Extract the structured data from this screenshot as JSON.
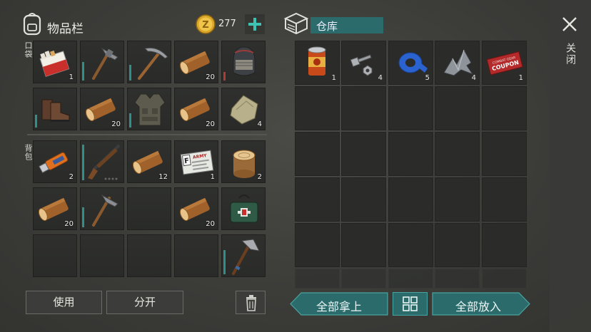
{
  "inventory": {
    "title": "物品栏",
    "currency_amount": "277",
    "currency_symbol": "Z",
    "pocket_label": "口袋",
    "backpack_label": "背包",
    "pocket_slots": [
      {
        "item": "cigarettes",
        "count": "1"
      },
      {
        "item": "pickaxe-hammer",
        "count": ""
      },
      {
        "item": "pickaxe",
        "count": ""
      },
      {
        "item": "log",
        "count": "20"
      },
      {
        "item": "helmet",
        "count": ""
      },
      {
        "item": "boots",
        "count": ""
      },
      {
        "item": "log",
        "count": "20"
      },
      {
        "item": "armor-vest",
        "count": ""
      },
      {
        "item": "log",
        "count": "20"
      },
      {
        "item": "cloth",
        "count": "4"
      }
    ],
    "backpack_slots": [
      {
        "item": "usb-flash",
        "count": "2"
      },
      {
        "item": "shotgun",
        "count": ""
      },
      {
        "item": "log",
        "count": "12"
      },
      {
        "item": "army-id-card",
        "count": "1"
      },
      {
        "item": "log-stump",
        "count": "2"
      },
      {
        "item": "log",
        "count": "20"
      },
      {
        "item": "hammer",
        "count": ""
      },
      {
        "item": "empty",
        "count": ""
      },
      {
        "item": "log",
        "count": "20"
      },
      {
        "item": "medkit-bag",
        "count": ""
      },
      {
        "item": "empty",
        "count": ""
      },
      {
        "item": "empty",
        "count": ""
      },
      {
        "item": "empty",
        "count": ""
      },
      {
        "item": "empty",
        "count": ""
      },
      {
        "item": "hatchet",
        "count": ""
      }
    ],
    "card_text": "ARMY",
    "card_letter": "F",
    "use_button": "使用",
    "split_button": "分开"
  },
  "storage": {
    "title": "仓库",
    "slots": [
      {
        "item": "canned-food",
        "count": "1"
      },
      {
        "item": "bolts-nuts",
        "count": "4"
      },
      {
        "item": "duct-tape",
        "count": "5"
      },
      {
        "item": "metal-scrap",
        "count": "4"
      },
      {
        "item": "coupon-ticket",
        "count": "1"
      }
    ],
    "coupon_text_1": "COMBAT GEAR",
    "coupon_text_2": "COUPON",
    "take_all_button": "全部拿上",
    "put_all_button": "全部放入"
  },
  "close_label": "关闭",
  "colors": {
    "accent_teal": "#2c6b6b",
    "durability_teal": "#2f8f8a",
    "durability_red": "#b23a32",
    "coin_gold": "#d9a82a"
  }
}
